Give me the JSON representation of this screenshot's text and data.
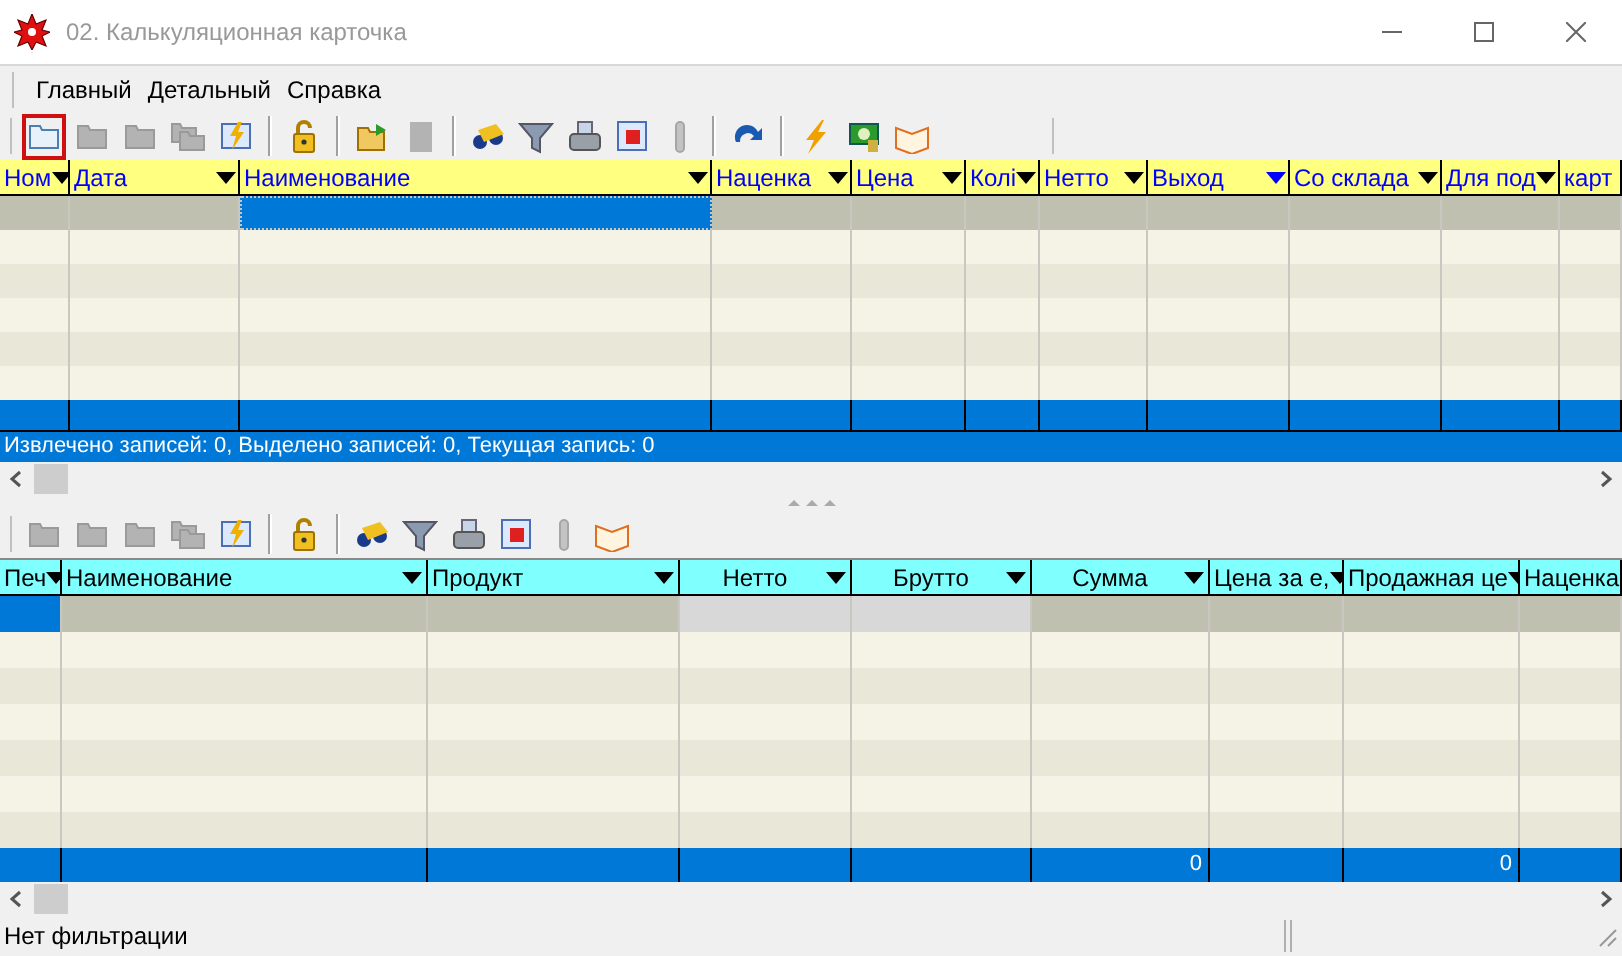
{
  "window": {
    "title": "02. Калькуляционная карточка"
  },
  "menu": [
    "Главный",
    "Детальный",
    "Справка"
  ],
  "top_toolbar": [
    {
      "disabled": false,
      "selected": true
    },
    {
      "disabled": true,
      "selected": false
    },
    {
      "disabled": true,
      "selected": false
    },
    {
      "disabled": true,
      "selected": false
    },
    {
      "disabled": false,
      "selected": false
    },
    {
      "disabled": false,
      "selected": false
    },
    {
      "disabled": false,
      "selected": false
    },
    {
      "disabled": true,
      "selected": false
    },
    {
      "disabled": false,
      "selected": false
    },
    {
      "disabled": false,
      "selected": false
    },
    {
      "disabled": false,
      "selected": false
    },
    {
      "disabled": false,
      "selected": false
    },
    {
      "disabled": true,
      "selected": false
    },
    {
      "disabled": false,
      "selected": false
    },
    {
      "disabled": false,
      "selected": false
    },
    {
      "disabled": false,
      "selected": false
    },
    {
      "disabled": false,
      "selected": false
    }
  ],
  "top_grid": {
    "columns": [
      {
        "label": "Ном",
        "dropdown": true,
        "active": false,
        "current": false
      },
      {
        "label": "Дата",
        "dropdown": true,
        "active": false,
        "current": false
      },
      {
        "label": "Наименование",
        "dropdown": true,
        "active": false,
        "current": true
      },
      {
        "label": "Наценка",
        "dropdown": true,
        "active": false,
        "current": false
      },
      {
        "label": "Цена",
        "dropdown": true,
        "active": false,
        "current": false
      },
      {
        "label": "Колі",
        "dropdown": true,
        "active": false,
        "current": false
      },
      {
        "label": "Нетто",
        "dropdown": true,
        "active": false,
        "current": false
      },
      {
        "label": "Выход",
        "dropdown": true,
        "active": true,
        "current": false
      },
      {
        "label": "Со склада",
        "dropdown": true,
        "active": false,
        "current": false
      },
      {
        "label": "Для под",
        "dropdown": true,
        "active": false,
        "current": false
      },
      {
        "label": "карт",
        "dropdown": false,
        "current": false
      }
    ],
    "status": "Извлечено записей: 0, Выделено записей: 0, Текущая запись: 0"
  },
  "bottom_toolbar": [
    {
      "disabled": true,
      "selected": false
    },
    {
      "disabled": true,
      "selected": false
    },
    {
      "disabled": true,
      "selected": false
    },
    {
      "disabled": true,
      "selected": false
    },
    {
      "disabled": false,
      "selected": false
    },
    {
      "disabled": false,
      "selected": false
    },
    {
      "disabled": false,
      "selected": false
    },
    {
      "disabled": false,
      "selected": false
    },
    {
      "disabled": false,
      "selected": false
    },
    {
      "disabled": false,
      "selected": false
    },
    {
      "disabled": true,
      "selected": false
    },
    {
      "disabled": false,
      "selected": false
    }
  ],
  "bottom_grid": {
    "columns": [
      {
        "label": "Печ",
        "dropdown": true,
        "current": true,
        "centered": false
      },
      {
        "label": "Наименование",
        "dropdown": true,
        "current": false,
        "centered": false,
        "light": false
      },
      {
        "label": "Продукт",
        "dropdown": true,
        "current": false,
        "centered": false,
        "light": false
      },
      {
        "label": "Нетто",
        "dropdown": true,
        "current": false,
        "centered": true,
        "light": true
      },
      {
        "label": "Брутто",
        "dropdown": true,
        "current": false,
        "centered": true,
        "light": true
      },
      {
        "label": "Сумма",
        "dropdown": true,
        "current": false,
        "centered": true,
        "light": false,
        "total": "0"
      },
      {
        "label": "Цена за е,",
        "dropdown": true,
        "current": false,
        "centered": false,
        "light": false
      },
      {
        "label": "Продажная це",
        "dropdown": true,
        "current": false,
        "centered": false,
        "light": false,
        "total": "0"
      },
      {
        "label": "Наценка",
        "current": false,
        "light": false
      }
    ]
  },
  "status_bar": "Нет фильтрации"
}
